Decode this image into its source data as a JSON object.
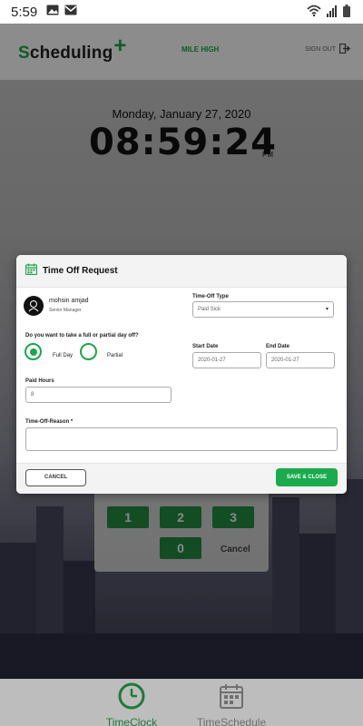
{
  "status_bar": {
    "time": "5:59",
    "icons": [
      "image-icon",
      "mail-icon",
      "wifi-icon",
      "signal-icon",
      "battery-icon"
    ]
  },
  "header": {
    "logo_first": "S",
    "logo_rest": "cheduling",
    "logo_plus": "+",
    "venue": "MILE HIGH",
    "sign_out": "SIGN OUT"
  },
  "clock": {
    "date": "Monday, January 27, 2020",
    "time": "08:59:24",
    "ampm": "PM"
  },
  "keypad": {
    "keys": [
      "1",
      "2",
      "3",
      "0"
    ],
    "cancel": "Cancel"
  },
  "modal": {
    "title": "Time Off Request",
    "employee_name": "mohsin amjad",
    "employee_role": "Senior Manager",
    "type_label": "Time-Off Type",
    "type_value": "Paid Sick",
    "question": "Do you want to take a full or partial day off?",
    "full_day": "Full Day",
    "partial": "Partial",
    "start_label": "Start Date",
    "start_value": "2020-01-27",
    "end_label": "End Date",
    "end_value": "2020-01-27",
    "hours_label": "Paid Hours",
    "hours_value": "8",
    "reason_label": "Time-Off-Reason *",
    "cancel_label": "CANCEL",
    "save_label": "SAVE & CLOSE"
  },
  "bottom_nav": {
    "timeclock": "TimeClock",
    "timeschedule": "TimeSchedule"
  },
  "colors": {
    "accent": "#1aa64a",
    "key_green": "#1e8e3e"
  }
}
